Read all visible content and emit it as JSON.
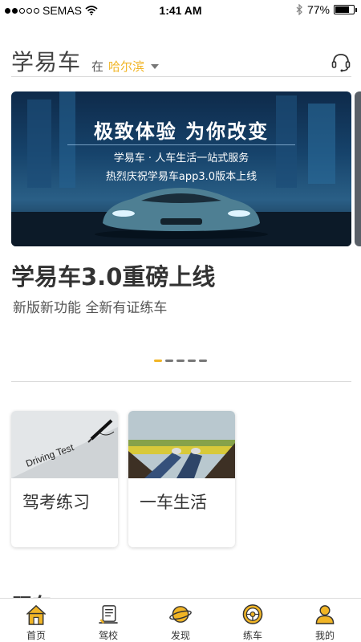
{
  "status_bar": {
    "carrier": "SEMAS",
    "time": "1:41 AM",
    "battery": "77%",
    "battery_level": 0.77,
    "signal_bars": 2
  },
  "header": {
    "title": "学易车",
    "city_prefix": "在",
    "city": "哈尔滨",
    "icons": [
      "headset-icon",
      "chevron-down-icon"
    ]
  },
  "banner": {
    "headline": "极致体验 为你改变",
    "line1": "学易车 · 人车生活一站式服务",
    "line2": "热烈庆祝学易车app3.0版本上线"
  },
  "promo": {
    "title": "学易车3.0重磅上线",
    "subtitle": "新版新功能 全新有证练车"
  },
  "pager": {
    "count": 5,
    "active": 0
  },
  "cards": [
    {
      "label": "驾考练习",
      "image_text": "Driving Test"
    },
    {
      "label": "一车生活"
    }
  ],
  "next_section_heading": "玩车",
  "tabs": [
    {
      "label": "首页",
      "icon": "home-icon"
    },
    {
      "label": "驾校",
      "icon": "school-icon"
    },
    {
      "label": "发现",
      "icon": "planet-icon"
    },
    {
      "label": "练车",
      "icon": "steering-wheel-icon"
    },
    {
      "label": "我的",
      "icon": "user-icon"
    }
  ],
  "colors": {
    "accent": "#f1b526",
    "text": "#333333",
    "divider": "#dadada"
  }
}
